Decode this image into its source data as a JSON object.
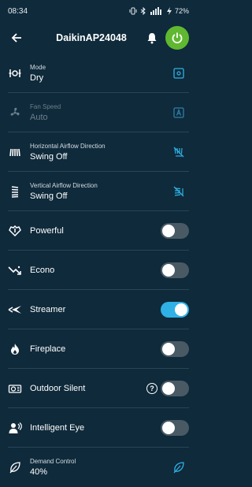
{
  "status_bar": {
    "time": "08:34",
    "battery": "72%"
  },
  "header": {
    "title": "DaikinAP24048"
  },
  "rows": {
    "mode": {
      "label": "Mode",
      "value": "Dry"
    },
    "fan_speed": {
      "label": "Fan Speed",
      "value": "Auto",
      "enabled": false
    },
    "horizontal": {
      "label": "Horizontal Airflow Direction",
      "value": "Swing Off"
    },
    "vertical": {
      "label": "Vertical Airflow Direction",
      "value": "Swing Off"
    },
    "powerful": {
      "label": "Powerful",
      "on": false
    },
    "econo": {
      "label": "Econo",
      "on": false
    },
    "streamer": {
      "label": "Streamer",
      "on": true
    },
    "fireplace": {
      "label": "Fireplace",
      "on": false
    },
    "outdoor_silent": {
      "label": "Outdoor Silent",
      "on": false,
      "help_label": "?"
    },
    "intelligent_eye": {
      "label": "Intelligent Eye",
      "on": false
    },
    "demand_control": {
      "label": "Demand Control",
      "value": "40%"
    }
  },
  "colors": {
    "background": "#0f2a3b",
    "accent": "#2fb1e5",
    "power": "#5fb830",
    "toggle_off": "#4a5a64"
  }
}
